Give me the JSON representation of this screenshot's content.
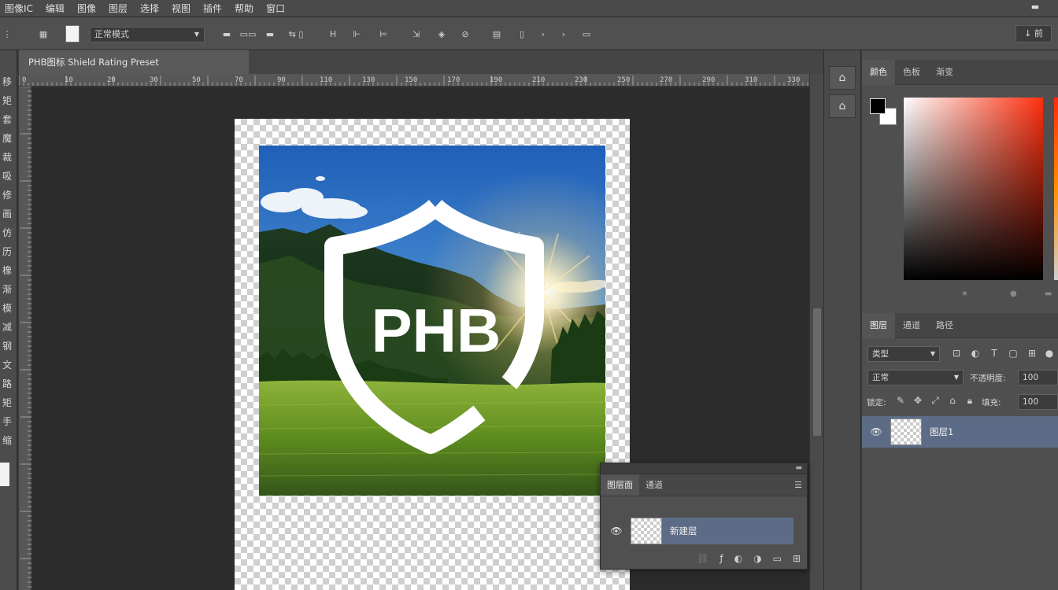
{
  "menu": [
    "图像IC",
    "编辑",
    "图像",
    "图层",
    "选择",
    "视图",
    "插件",
    "帮助",
    "窗口"
  ],
  "window": {
    "minimize_icon": "minimize-icon"
  },
  "options_bar": {
    "tool_icon": "marquee-tool-icon",
    "mode_select": "正常模式",
    "right_box": "↓ 前"
  },
  "document": {
    "tab_title": "PHB图标 Shield Rating Preset",
    "logo_text": "PHB"
  },
  "ruler_top": [
    "0",
    "10",
    "20",
    "30",
    "50",
    "70",
    "90",
    "110",
    "130",
    "150",
    "170",
    "190",
    "210",
    "230",
    "250",
    "270",
    "290",
    "310",
    "330"
  ],
  "left_tools": [
    "移",
    "矩",
    "套",
    "魔",
    "裁",
    "吸",
    "修",
    "画",
    "仿",
    "历",
    "橡",
    "渐",
    "模",
    "减",
    "钢",
    "文",
    "路",
    "矩",
    "手",
    "缩"
  ],
  "color_panel": {
    "tabs": [
      "颜色",
      "色板",
      "渐变"
    ]
  },
  "layers_panel": {
    "tabs": [
      "图层",
      "通道",
      "路径"
    ],
    "filter_select": "类型",
    "blend_select": "正常",
    "opacity_label": "不透明度:",
    "opacity_value": "100",
    "lock_label": "锁定:",
    "fill_label": "填充:",
    "fill_value": "100",
    "layers": [
      {
        "name": "图层1",
        "visible": true
      }
    ]
  },
  "float_panel": {
    "tabs": [
      "图层面",
      "通道"
    ],
    "layers": [
      {
        "name": "新建层",
        "visible": true
      }
    ]
  }
}
